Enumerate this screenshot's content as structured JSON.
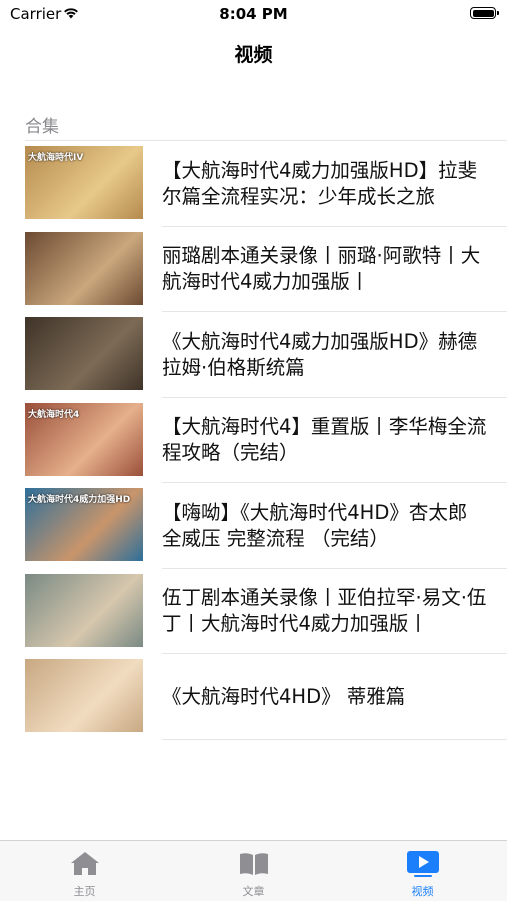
{
  "status_bar": {
    "carrier": "Carrier",
    "time": "8:04 PM"
  },
  "nav": {
    "title": "视频"
  },
  "section": {
    "header": "合集"
  },
  "items": [
    {
      "title": "【大航海时代4威力加强版HD】拉斐尔篇全流程实况：少年成长之旅",
      "thumb_caption": "大航海時代IV",
      "thumb_colors": [
        "#b58a4e",
        "#e7c98a"
      ]
    },
    {
      "title": "丽璐剧本通关录像丨丽璐·阿歌特丨大航海时代4威力加强版丨",
      "thumb_caption": "",
      "thumb_colors": [
        "#6b4a32",
        "#caa77c"
      ]
    },
    {
      "title": "《大航海时代4威力加强版HD》赫德拉姆·伯格斯统篇",
      "thumb_caption": "",
      "thumb_colors": [
        "#3f3328",
        "#7c6a55"
      ]
    },
    {
      "title": "【大航海时代4】重置版丨李华梅全流程攻略（完结）",
      "thumb_caption": "大航海时代4",
      "thumb_colors": [
        "#9a4f3a",
        "#e5b08b"
      ]
    },
    {
      "title": "【嗨呦】《大航海时代4HD》杏太郎 全威压 完整流程 （完结）",
      "thumb_caption": "大航海时代4威力加强HD",
      "thumb_colors": [
        "#2e6f9a",
        "#c9956b"
      ]
    },
    {
      "title": "伍丁剧本通关录像丨亚伯拉罕·易文·伍丁丨大航海时代4威力加强版丨",
      "thumb_caption": "",
      "thumb_colors": [
        "#7a8a84",
        "#d6c7ad"
      ]
    },
    {
      "title": "《大航海时代4HD》 蒂雅篇",
      "thumb_caption": "",
      "thumb_colors": [
        "#c8a882",
        "#f1dcc0"
      ]
    }
  ],
  "tabs": [
    {
      "label": "主页",
      "icon": "home-icon",
      "active": false
    },
    {
      "label": "文章",
      "icon": "book-icon",
      "active": false
    },
    {
      "label": "视频",
      "icon": "play-icon",
      "active": true
    }
  ],
  "colors": {
    "accent": "#1b7ffb",
    "inactive": "#8e8e93",
    "separator": "#e5e5ea"
  }
}
